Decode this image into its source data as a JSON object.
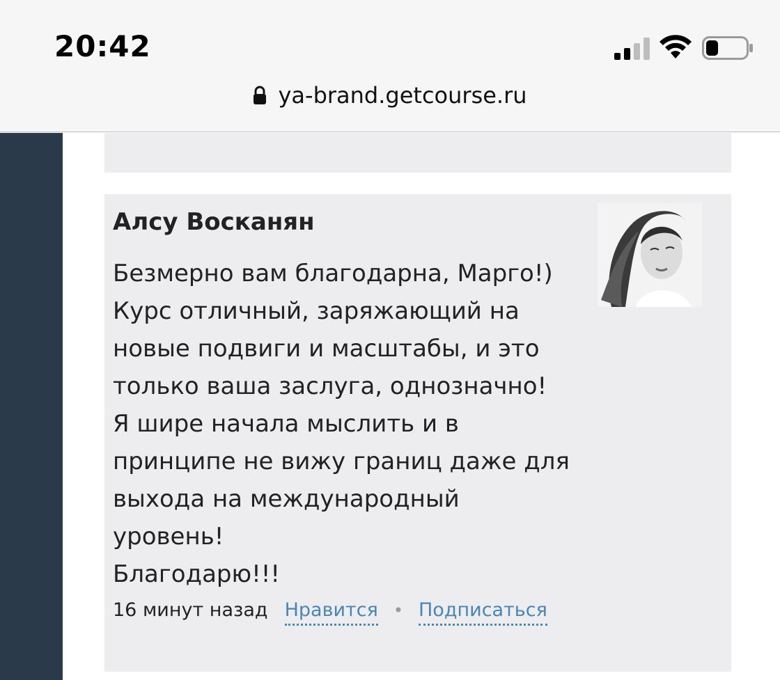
{
  "status_bar": {
    "time": "20:42",
    "signal_icon": "cellular-signal-icon",
    "wifi_icon": "wifi-icon",
    "battery_icon": "battery-icon",
    "battery_level": 0.3
  },
  "browser": {
    "lock_icon": "lock-icon",
    "url": "ya-brand.getcourse.ru"
  },
  "comment": {
    "author": "Алсу Восканян",
    "avatar_alt": "avatar",
    "text": "Безмерно вам благодарна, Марго!)\nКурс отличный, заряжающий на\nновые подвиги и масштабы, и это\nтолько ваша заслуга, однозначно!\nЯ шире начала мыслить и в\nпринципе не вижу границ даже для\nвыхода на международный\nуровень!\nБлагодарю!!!",
    "time_ago": "16 минут назад",
    "like_label": "Нравится",
    "separator": "•",
    "subscribe_label": "Подписаться"
  },
  "colors": {
    "sidebar": "#2b3a4b",
    "card_bg": "#ededf0",
    "link": "#4a86b5"
  }
}
